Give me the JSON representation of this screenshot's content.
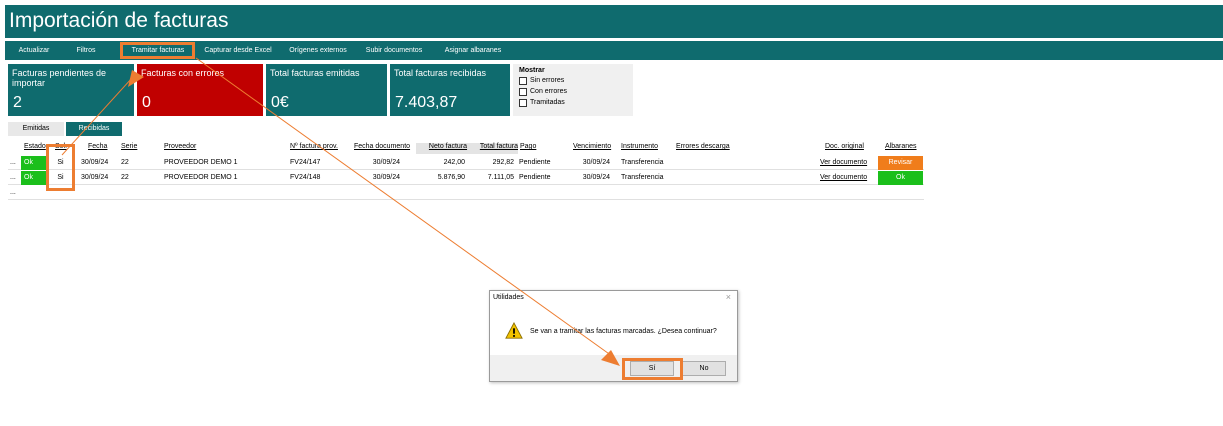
{
  "window": {
    "title": "Importación de facturas"
  },
  "menu": [
    "Actualizar",
    "Filtros",
    "Tramitar facturas",
    "Capturar desde Excel",
    "Orígenes externos",
    "Subir documentos",
    "Asignar albaranes"
  ],
  "cards": [
    {
      "label": "Facturas pendientes de importar",
      "value": "2"
    },
    {
      "label": "Facturas con errores",
      "value": "0"
    },
    {
      "label": "Total facturas emitidas",
      "value": "0€"
    },
    {
      "label": "Total facturas recibidas",
      "value": "7.403,87"
    }
  ],
  "mostrar": {
    "title": "Mostrar",
    "options": [
      "Sin errores",
      "Con errores",
      "Tramitadas"
    ]
  },
  "tabs": [
    "Emitidas",
    "Recibidas"
  ],
  "table": {
    "headers": [
      "Estado",
      "Sel.",
      "Fecha",
      "Serie",
      "Proveedor",
      "Nº factura prov.",
      "Fecha documento",
      "Neto factura",
      "Total factura",
      "Pago",
      "Vencimiento",
      "Instrumento",
      "Errores descarga",
      "Doc. original",
      "Albaranes"
    ],
    "rows": [
      {
        "marker": "...",
        "estado": "Ok",
        "sel": "Si",
        "fecha": "30/09/24",
        "serie": "22",
        "proveedor": "PROVEEDOR DEMO 1",
        "nfactura": "FV24/147",
        "fecha_doc": "30/09/24",
        "neto": "242,00",
        "total": "292,82",
        "pago": "Pendiente",
        "vencimiento": "30/09/24",
        "instrumento": "Transferencia",
        "errores": "",
        "doc": "Ver documento",
        "albaranes": "Revisar"
      },
      {
        "marker": "...",
        "estado": "Ok",
        "sel": "Si",
        "fecha": "30/09/24",
        "serie": "22",
        "proveedor": "PROVEEDOR DEMO 1",
        "nfactura": "FV24/148",
        "fecha_doc": "30/09/24",
        "neto": "5.876,90",
        "total": "7.111,05",
        "pago": "Pendiente",
        "vencimiento": "30/09/24",
        "instrumento": "Transferencia",
        "errores": "",
        "doc": "Ver documento",
        "albaranes": "Ok"
      }
    ],
    "new_row_marker": "..."
  },
  "dialog": {
    "title": "Utilidades",
    "close": "×",
    "icon": "warning-icon",
    "message": "Se van a tramitar las facturas marcadas. ¿Desea continuar?",
    "yes": "Sí",
    "no": "No"
  },
  "colors": {
    "teal": "#0f6b6e",
    "red": "#c00000",
    "green": "#1bbf1b",
    "orange": "#f07d1b",
    "highlight": "#ed7d31"
  }
}
